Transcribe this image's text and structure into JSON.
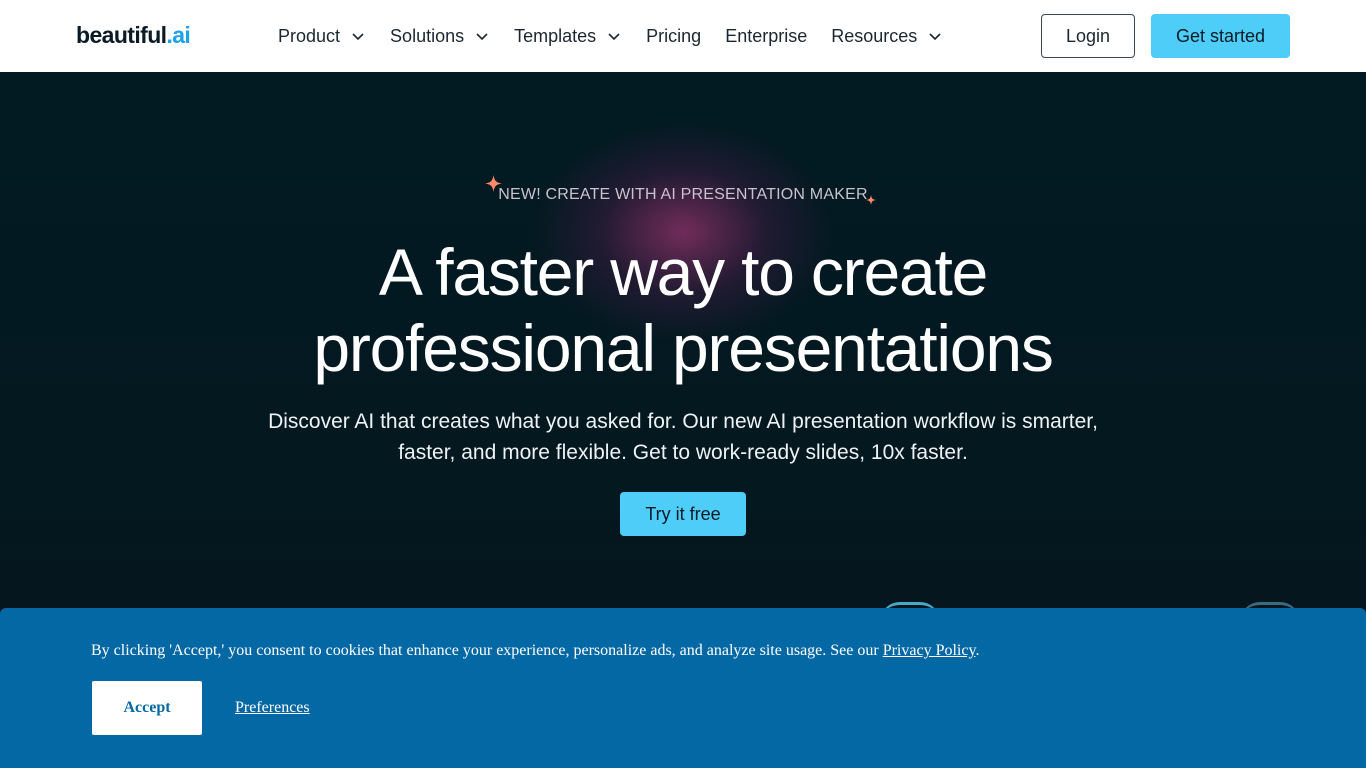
{
  "brand": {
    "name": "beautiful",
    "suffix": ".ai",
    "accent": "#1aa3e8"
  },
  "nav": {
    "items": [
      {
        "label": "Product",
        "dropdown": true
      },
      {
        "label": "Solutions",
        "dropdown": true
      },
      {
        "label": "Templates",
        "dropdown": true
      },
      {
        "label": "Pricing",
        "dropdown": false
      },
      {
        "label": "Enterprise",
        "dropdown": false
      },
      {
        "label": "Resources",
        "dropdown": true
      }
    ],
    "login_label": "Login",
    "get_started_label": "Get started"
  },
  "hero": {
    "eyebrow": "NEW! CREATE WITH AI PRESENTATION MAKER",
    "headline_line1": "A faster way to create",
    "headline_line2": "professional presentations",
    "subtext_line1": "Discover AI that creates what you asked for. Our new AI presentation workflow is smarter,",
    "subtext_line2": "faster, and more flexible. Get to work-ready slides, 10x faster.",
    "cta_label": "Try it free",
    "cta_color": "#4dcdf8"
  },
  "cookie": {
    "message": "By clicking 'Accept,' you consent to cookies that enhance your experience, personalize ads, and analyze site usage. See our ",
    "policy_link": "Privacy Policy",
    "policy_suffix": ".",
    "accept_label": "Accept",
    "preferences_label": "Preferences",
    "background": "#0468a4"
  }
}
